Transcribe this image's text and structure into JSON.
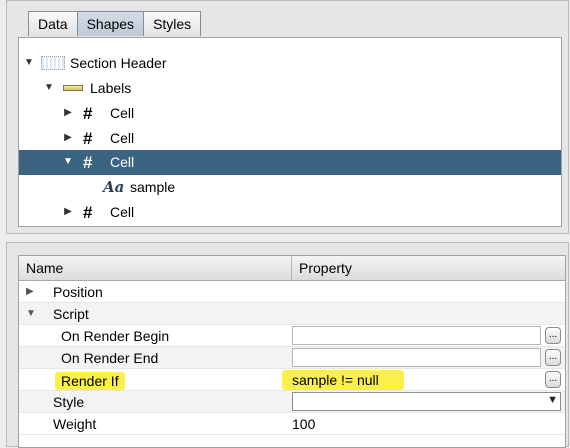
{
  "tabs": [
    "Data",
    "Shapes",
    "Styles"
  ],
  "active_tab": "Shapes",
  "tree": {
    "section_header": "Section Header",
    "labels": "Labels",
    "cell_1": "Cell",
    "cell_2": "Cell",
    "cell_3": "Cell",
    "sample": "sample",
    "cell_4": "Cell"
  },
  "grid": {
    "header_name": "Name",
    "header_property": "Property",
    "rows": {
      "position": "Position",
      "script": "Script",
      "on_render_begin": "On Render Begin",
      "on_render_begin_value": "",
      "on_render_end": "On Render End",
      "on_render_end_value": "",
      "render_if": "Render If",
      "render_if_value": "sample != null",
      "style": "Style",
      "style_value": "",
      "weight": "Weight",
      "weight_value": "100"
    },
    "ellipsis_label": "..."
  },
  "colors": {
    "selection": "#3b6482",
    "highlight": "#fbf04a"
  },
  "icons": {
    "section_header": "section-header-icon",
    "labels": "labels-icon",
    "cell": "cell-grid-icon",
    "sample": "text-field-icon"
  }
}
